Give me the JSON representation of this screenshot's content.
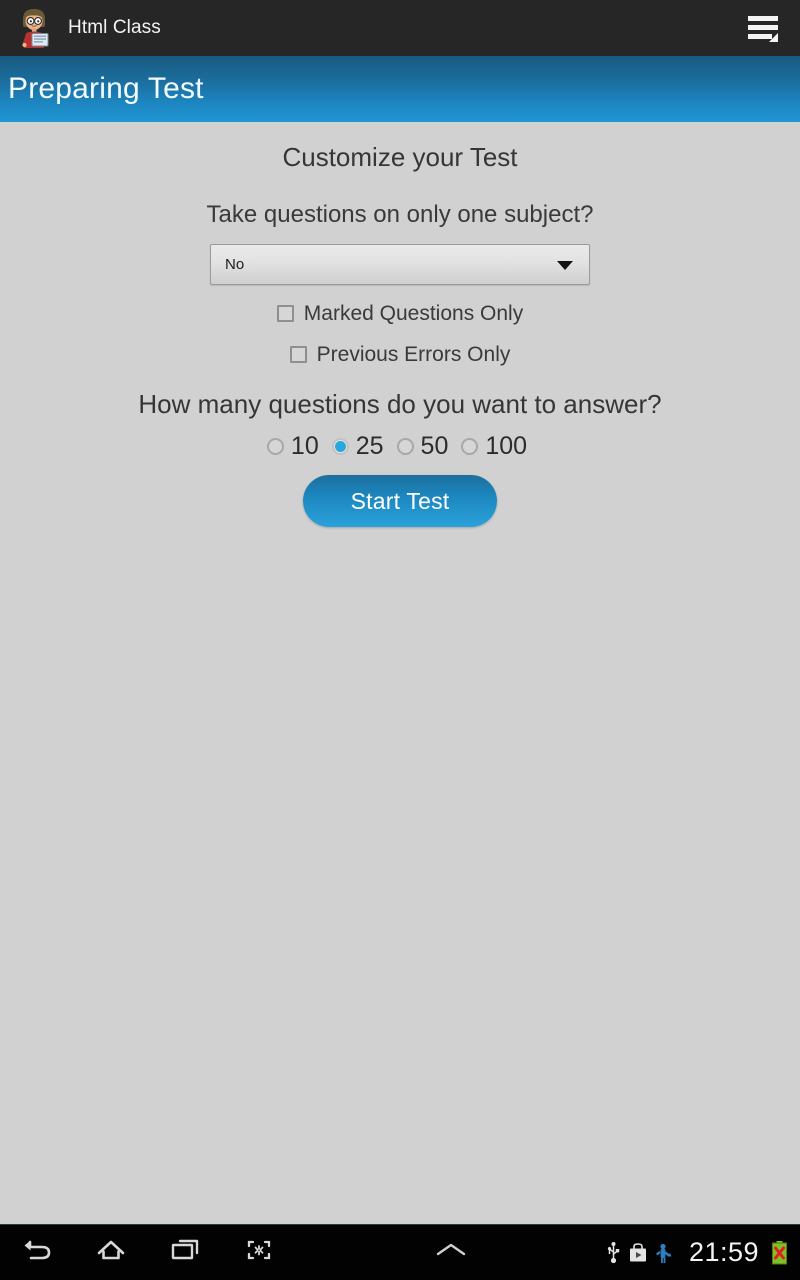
{
  "appbar": {
    "logo_icon": "student-avatar-icon",
    "title": "Html Class",
    "menu_icon": "hamburger-menu-icon"
  },
  "page_header": {
    "title": "Preparing Test",
    "accent_color": "#1d86c1"
  },
  "content": {
    "section_title": "Customize your Test",
    "subject_question": {
      "label": "Take questions on only one subject?",
      "select_value": "No",
      "select_options": [
        "No"
      ],
      "arrow_icon": "chevron-down-icon"
    },
    "checkboxes": [
      {
        "label": "Marked Questions Only",
        "checked": false
      },
      {
        "label": "Previous Errors Only",
        "checked": false
      }
    ],
    "count_question": {
      "label": "How many questions do you want to answer?",
      "options": [
        {
          "label": "10",
          "selected": false
        },
        {
          "label": "25",
          "selected": true
        },
        {
          "label": "50",
          "selected": false
        },
        {
          "label": "100",
          "selected": false
        }
      ],
      "selected_value": "25",
      "selected_color": "#29a8dd"
    },
    "start_button": {
      "label": "Start Test",
      "color": "#1d87c0"
    }
  },
  "navbar": {
    "buttons": [
      {
        "icon": "back-arrow-icon"
      },
      {
        "icon": "home-icon"
      },
      {
        "icon": "recent-apps-icon"
      },
      {
        "icon": "screenshot-icon"
      },
      {
        "icon": "chevron-up-icon"
      }
    ],
    "status": {
      "icons": [
        {
          "icon": "usb-icon"
        },
        {
          "icon": "play-store-icon"
        },
        {
          "icon": "android-debug-icon"
        }
      ],
      "time": "21:59",
      "battery_icon": "battery-error-icon",
      "battery_color": "#7fc02a"
    }
  }
}
